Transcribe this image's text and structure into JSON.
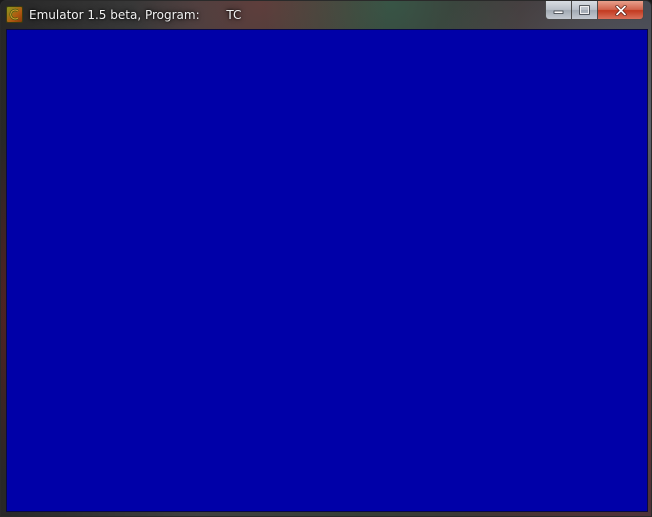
{
  "window": {
    "title": "Emulator 1.5 beta, Program:       TC",
    "icon": "emulator-app-icon",
    "controls": {
      "minimize_icon": "minimize-icon",
      "maximize_icon": "maximize-icon",
      "close_icon": "close-icon"
    }
  },
  "screen": {
    "background_color": "#0000A8"
  }
}
